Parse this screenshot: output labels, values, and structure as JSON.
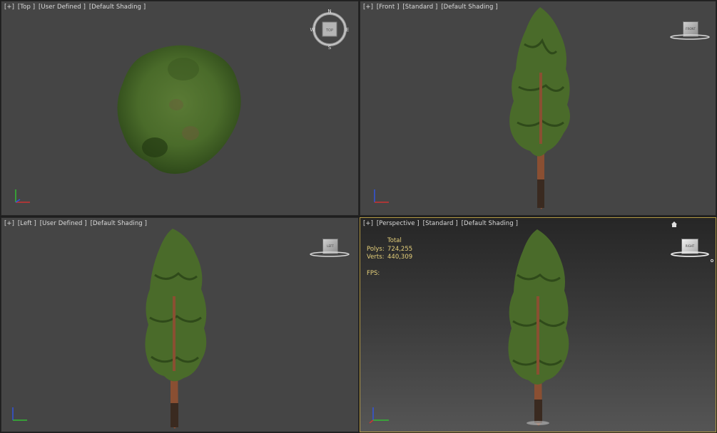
{
  "viewports": {
    "top": {
      "plus": "[+]",
      "view": "[Top ]",
      "mode": "[User Defined ]",
      "shading": "[Default Shading ]",
      "cube_face": "TOP"
    },
    "front": {
      "plus": "[+]",
      "view": "[Front ]",
      "mode": "[Standard ]",
      "shading": "[Default Shading ]",
      "cube_face": "FRONT"
    },
    "left": {
      "plus": "[+]",
      "view": "[Left ]",
      "mode": "[User Defined ]",
      "shading": "[Default Shading ]",
      "cube_face": "LEFT"
    },
    "perspective": {
      "plus": "[+]",
      "view": "[Perspective ]",
      "mode": "[Standard ]",
      "shading": "[Default Shading ]",
      "cube_face": "RIGHT",
      "stats": {
        "header": "Total",
        "polys_label": "Polys:",
        "polys_value": "724,255",
        "verts_label": "Verts:",
        "verts_value": "440,309",
        "fps_label": "FPS:"
      }
    }
  },
  "compass": {
    "n": "N",
    "s": "S",
    "e": "E",
    "w": "W"
  },
  "colors": {
    "viewport_bg": "#454545",
    "active_border": "#b49a45",
    "stats_text": "#e6d07a",
    "foliage": "#4a6b2a",
    "trunk": "#8a4f32",
    "axis_x": "#cc3333",
    "axis_y": "#33bb33",
    "axis_z": "#3355dd"
  },
  "icons": {
    "viewcube": "viewcube-icon",
    "compass": "compass-ring-icon",
    "axis_tripod": "axis-tripod-icon",
    "home": "home-icon"
  }
}
